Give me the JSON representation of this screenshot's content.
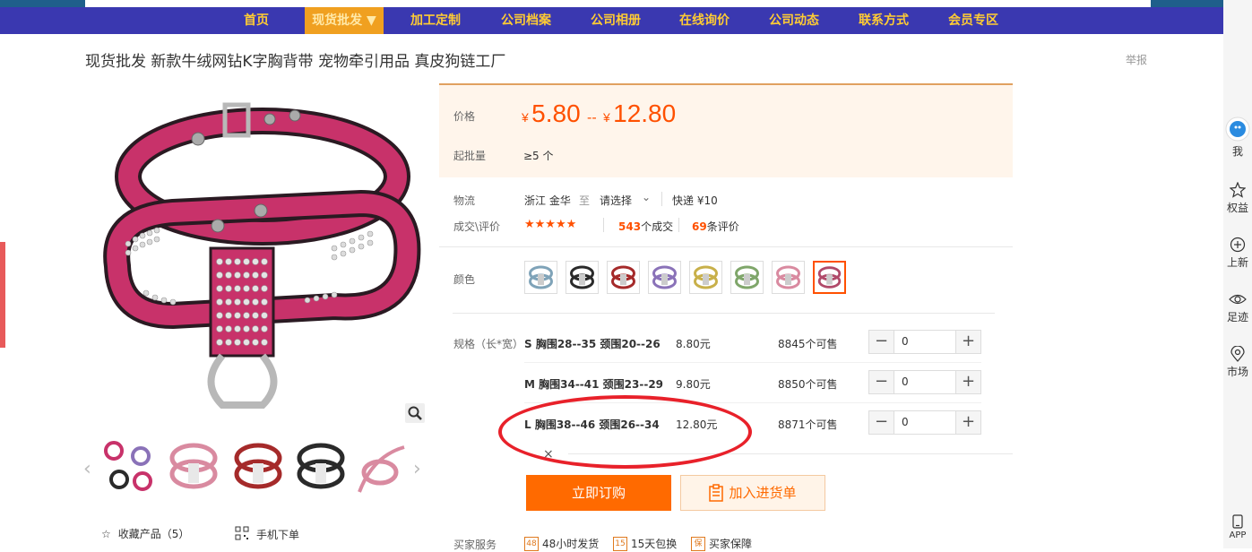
{
  "nav": {
    "items": [
      {
        "label": "首页"
      },
      {
        "label": "现货批发 ▼"
      },
      {
        "label": "加工定制"
      },
      {
        "label": "公司档案"
      },
      {
        "label": "公司相册"
      },
      {
        "label": "在线询价"
      },
      {
        "label": "公司动态"
      },
      {
        "label": "联系方式"
      },
      {
        "label": "会员专区"
      }
    ]
  },
  "product": {
    "title": "现货批发 新款牛绒网钻K字胸背带 宠物牵引用品 真皮狗链工厂",
    "report": "举报"
  },
  "price": {
    "label": "价格",
    "currency": "¥",
    "low": "5.80",
    "dash": "--",
    "high": "12.80",
    "min_order_label": "起批量",
    "min_order_value": "≥5 个"
  },
  "logistics": {
    "label": "物流",
    "from": "浙江 金华",
    "to_word": "至",
    "select": "请选择",
    "express": "快递 ¥10"
  },
  "reviews": {
    "label": "成交\\评价",
    "stars": "★★★★★",
    "deals_count": "543",
    "deals_suffix": "个成交",
    "review_count": "69",
    "review_suffix": "条评价"
  },
  "color": {
    "label": "颜色",
    "swatches": [
      {
        "name": "gray-blue",
        "hex": "#7fa3b8"
      },
      {
        "name": "black",
        "hex": "#2a2a2a"
      },
      {
        "name": "red",
        "hex": "#a52a2a"
      },
      {
        "name": "purple",
        "hex": "#8a72b8"
      },
      {
        "name": "yellow",
        "hex": "#c8b04a"
      },
      {
        "name": "green",
        "hex": "#7fa66a"
      },
      {
        "name": "pink",
        "hex": "#d98aa0"
      },
      {
        "name": "rose",
        "hex": "#b04a6a"
      }
    ],
    "selected_index": 7
  },
  "specs": {
    "label": "规格（长*宽）",
    "rows": [
      {
        "name": "S 胸围28--35 颈围20--26",
        "price": "8.80元",
        "stock": "8845个可售",
        "qty": "0"
      },
      {
        "name": "M 胸围34--41 颈围23--29",
        "price": "9.80元",
        "stock": "8850个可售",
        "qty": "0"
      },
      {
        "name": "L 胸围38--46 颈围26--34",
        "price": "12.80元",
        "stock": "8871个可售",
        "qty": "0"
      }
    ],
    "collapse_icon": "×"
  },
  "actions": {
    "buy": "立即订购",
    "cart": "加入进货单",
    "favorite": "收藏产品（5）",
    "mobile": "手机下单"
  },
  "services": {
    "label": "买家服务",
    "items": [
      {
        "badge": "48",
        "text": "48小时发货"
      },
      {
        "badge": "15",
        "text": "15天包换"
      },
      {
        "badge": "保",
        "text": "买家保障"
      }
    ]
  },
  "rail": {
    "items": [
      {
        "label": "我"
      },
      {
        "label": "权益"
      },
      {
        "label": "上新"
      },
      {
        "label": "足迹"
      },
      {
        "label": "市场"
      },
      {
        "label": "APP"
      }
    ]
  },
  "colors": {
    "nav_bg": "#3a38b0",
    "nav_text": "#ffcc33",
    "accent": "#ff5000",
    "annotation": "#e8212a",
    "harness": "#c8326a"
  }
}
